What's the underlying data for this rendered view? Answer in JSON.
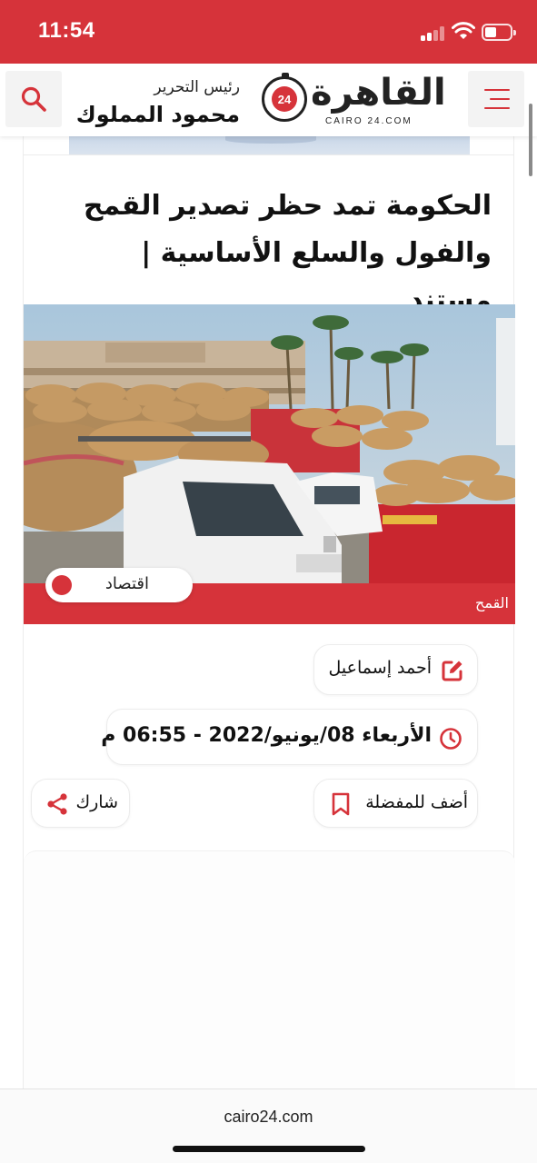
{
  "status_bar": {
    "time": "11:54",
    "battery_level": 0.45
  },
  "header": {
    "editor_label": "رئيس التحرير",
    "editor_name": "محمود المملوك",
    "logo_text": "القاهرة",
    "logo_badge": "24",
    "logo_subtext": "CAIRO 24.COM",
    "icons": {
      "search": "search-icon",
      "menu": "menu-icon"
    }
  },
  "article": {
    "headline": "الحكومة تمد حظر تصدير القمح والفول والسلع الأساسية | مستند",
    "image_caption": "القمح",
    "category": "اقتصاد",
    "author": "أحمد إسماعيل",
    "date": "الأربعاء 08/يونيو/2022 - 06:55 م",
    "favorite_label": "أضف للمفضلة",
    "share_label": "شارك",
    "icons": {
      "author": "edit-icon",
      "date": "clock-icon",
      "favorite": "bookmark-icon",
      "share": "share-icon"
    }
  },
  "browser": {
    "url": "cairo24.com"
  },
  "colors": {
    "brand": "#d6333a",
    "text": "#111111",
    "pill_border": "#ececec"
  }
}
